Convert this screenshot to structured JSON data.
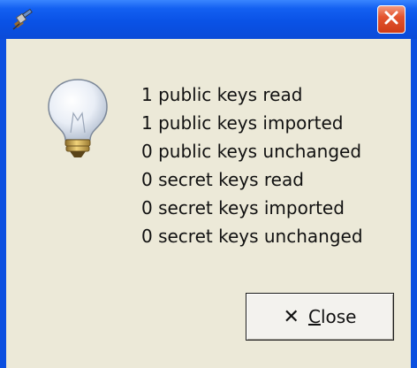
{
  "window": {
    "icons": {
      "app": "satellite-icon",
      "close": "close-icon",
      "message": "lightbulb-icon"
    },
    "colors": {
      "titlebar": "#0a52e6",
      "client": "#ece9d8",
      "close": "#d9471f"
    }
  },
  "messages": [
    "1 public keys read",
    "1 public keys imported",
    "0 public keys unchanged",
    "0 secret keys read",
    "0 secret keys imported",
    "0 secret keys unchanged"
  ],
  "close_button": {
    "mnemonic": "C",
    "label_rest": "lose"
  }
}
